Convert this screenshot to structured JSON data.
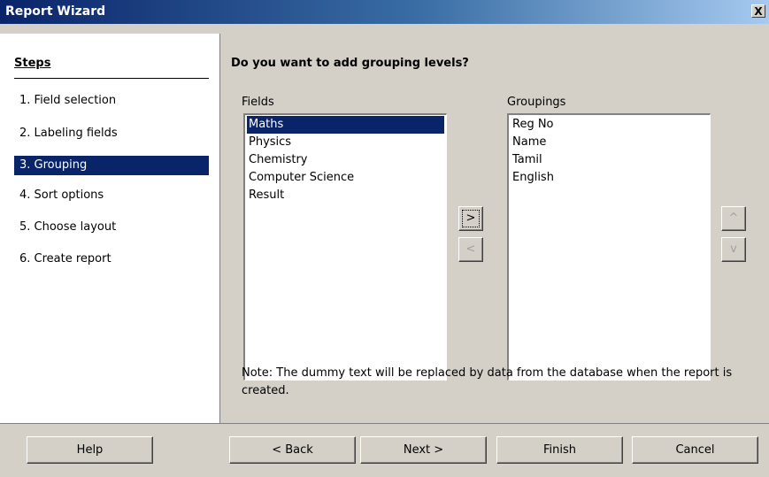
{
  "window": {
    "title": "Report Wizard",
    "close_label": "X"
  },
  "steps": {
    "header": "Steps",
    "items": [
      {
        "label": "1.  Field selection",
        "active": false
      },
      {
        "label": "2.  Labeling fields",
        "active": false
      },
      {
        "label": "3.  Grouping",
        "active": true
      },
      {
        "label": "4.  Sort options",
        "active": false
      },
      {
        "label": "5.  Choose layout",
        "active": false
      },
      {
        "label": "6.  Create report",
        "active": false
      }
    ]
  },
  "main": {
    "heading": "Do you want to add grouping levels?",
    "fields_label": "Fields",
    "fields": [
      "Maths",
      "Physics",
      "Chemistry",
      "Computer Science",
      "Result"
    ],
    "selected_field": "Maths",
    "groupings_label": "Groupings",
    "groupings": [
      "Reg No",
      "Name",
      "Tamil",
      "English"
    ],
    "add_button": ">",
    "remove_button": "<",
    "up_button": "^",
    "down_button": "v",
    "note": "Note: The dummy text will be replaced by data from the database when the report is created."
  },
  "footer": {
    "help": "Help",
    "back": "< Back",
    "next": "Next >",
    "finish": "Finish",
    "cancel": "Cancel"
  },
  "colors": {
    "selection": "#0a246a",
    "dialog_bg": "#d4d0c8"
  }
}
